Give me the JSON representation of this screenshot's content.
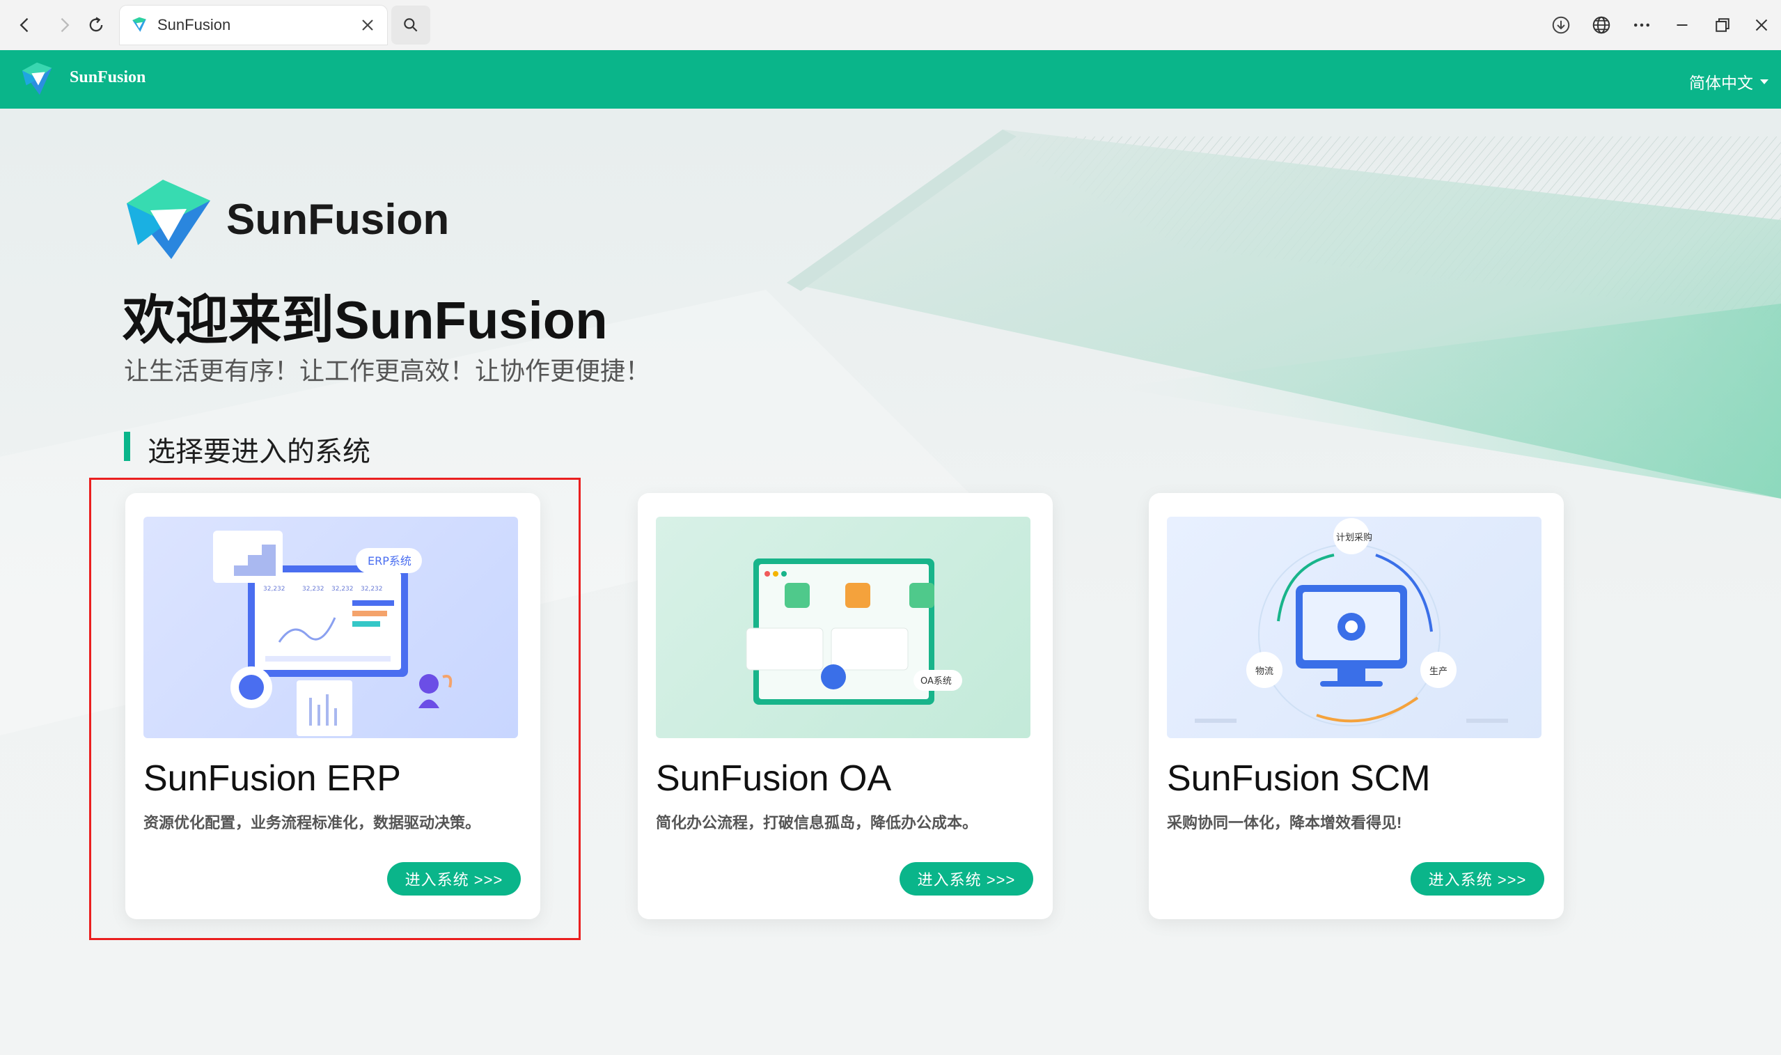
{
  "browser": {
    "tab_title": "SunFusion"
  },
  "header": {
    "brand": "SunFusion",
    "language": "简体中文"
  },
  "hero": {
    "brand": "SunFusion",
    "welcome": "欢迎来到SunFusion",
    "slogan": "让生活更有序！让工作更高效！让协作更便捷！",
    "section_title": "选择要进入的系统"
  },
  "cards": [
    {
      "title": "SunFusion ERP",
      "description": "资源优化配置，业务流程标准化，数据驱动决策。",
      "button": "进入系统 >>>",
      "illus_label": "ERP系统",
      "illus_nums": [
        "32,232",
        "32,232",
        "32,232",
        "32,232"
      ]
    },
    {
      "title": "SunFusion OA",
      "description": "简化办公流程，打破信息孤岛，降低办公成本。",
      "button": "进入系统 >>>",
      "illus_label": "OA系统"
    },
    {
      "title": "SunFusion SCM",
      "description": "采购协同一体化，降本增效看得见!",
      "button": "进入系统 >>>",
      "illus_labels": [
        "计划采购",
        "物流",
        "生产"
      ]
    }
  ],
  "colors": {
    "brand_green": "#0ab58a",
    "highlight_red": "#ea1f1f"
  }
}
